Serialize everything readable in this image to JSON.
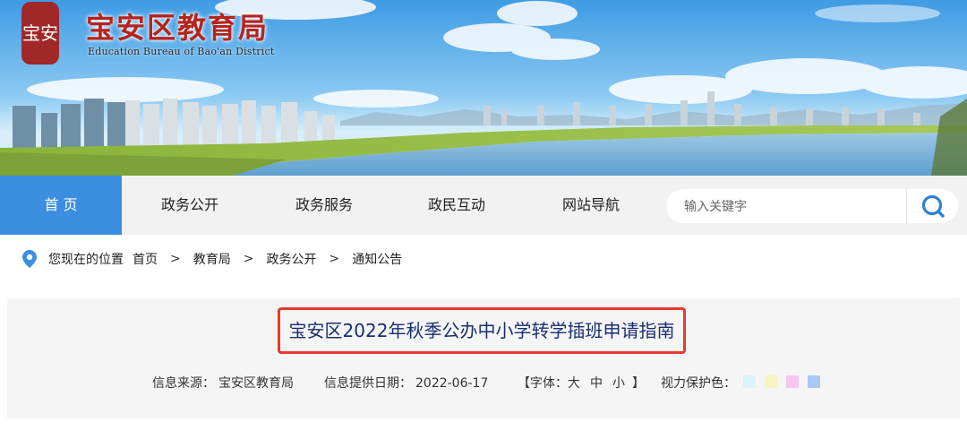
{
  "header": {
    "seal_text": "宝安",
    "title": "宝安区教育局",
    "subtitle": "Education Bureau of Bao'an District"
  },
  "nav": {
    "items": [
      {
        "label": "首 页",
        "active": true
      },
      {
        "label": "政务公开",
        "active": false
      },
      {
        "label": "政务服务",
        "active": false
      },
      {
        "label": "政民互动",
        "active": false
      },
      {
        "label": "网站导航",
        "active": false
      }
    ],
    "search_placeholder": "输入关键字",
    "search_icon": "search-icon"
  },
  "breadcrumb": {
    "prefix": "您现在的位置",
    "items": [
      "首页",
      "教育局",
      "政务公开",
      "通知公告"
    ],
    "separator": ">"
  },
  "article": {
    "title": "宝安区2022年秋季公办中小学转学插班申请指南",
    "source_label": "信息来源：",
    "source": "宝安区教育局",
    "date_label": "信息提供日期：",
    "date": "2022-06-17",
    "font_label": "【字体：",
    "font_sizes": [
      "大",
      "中",
      "小"
    ],
    "font_close": "】",
    "eye_label": "视力保护色：",
    "eye_colors": [
      "#d9f4fb",
      "#f8f3c2",
      "#f4c6f0",
      "#a9c8f2"
    ]
  },
  "colors": {
    "accent": "#3b8ee0",
    "title_border": "#e83a2e",
    "title_text": "#1a2d70",
    "brand_red": "#b4231e"
  }
}
